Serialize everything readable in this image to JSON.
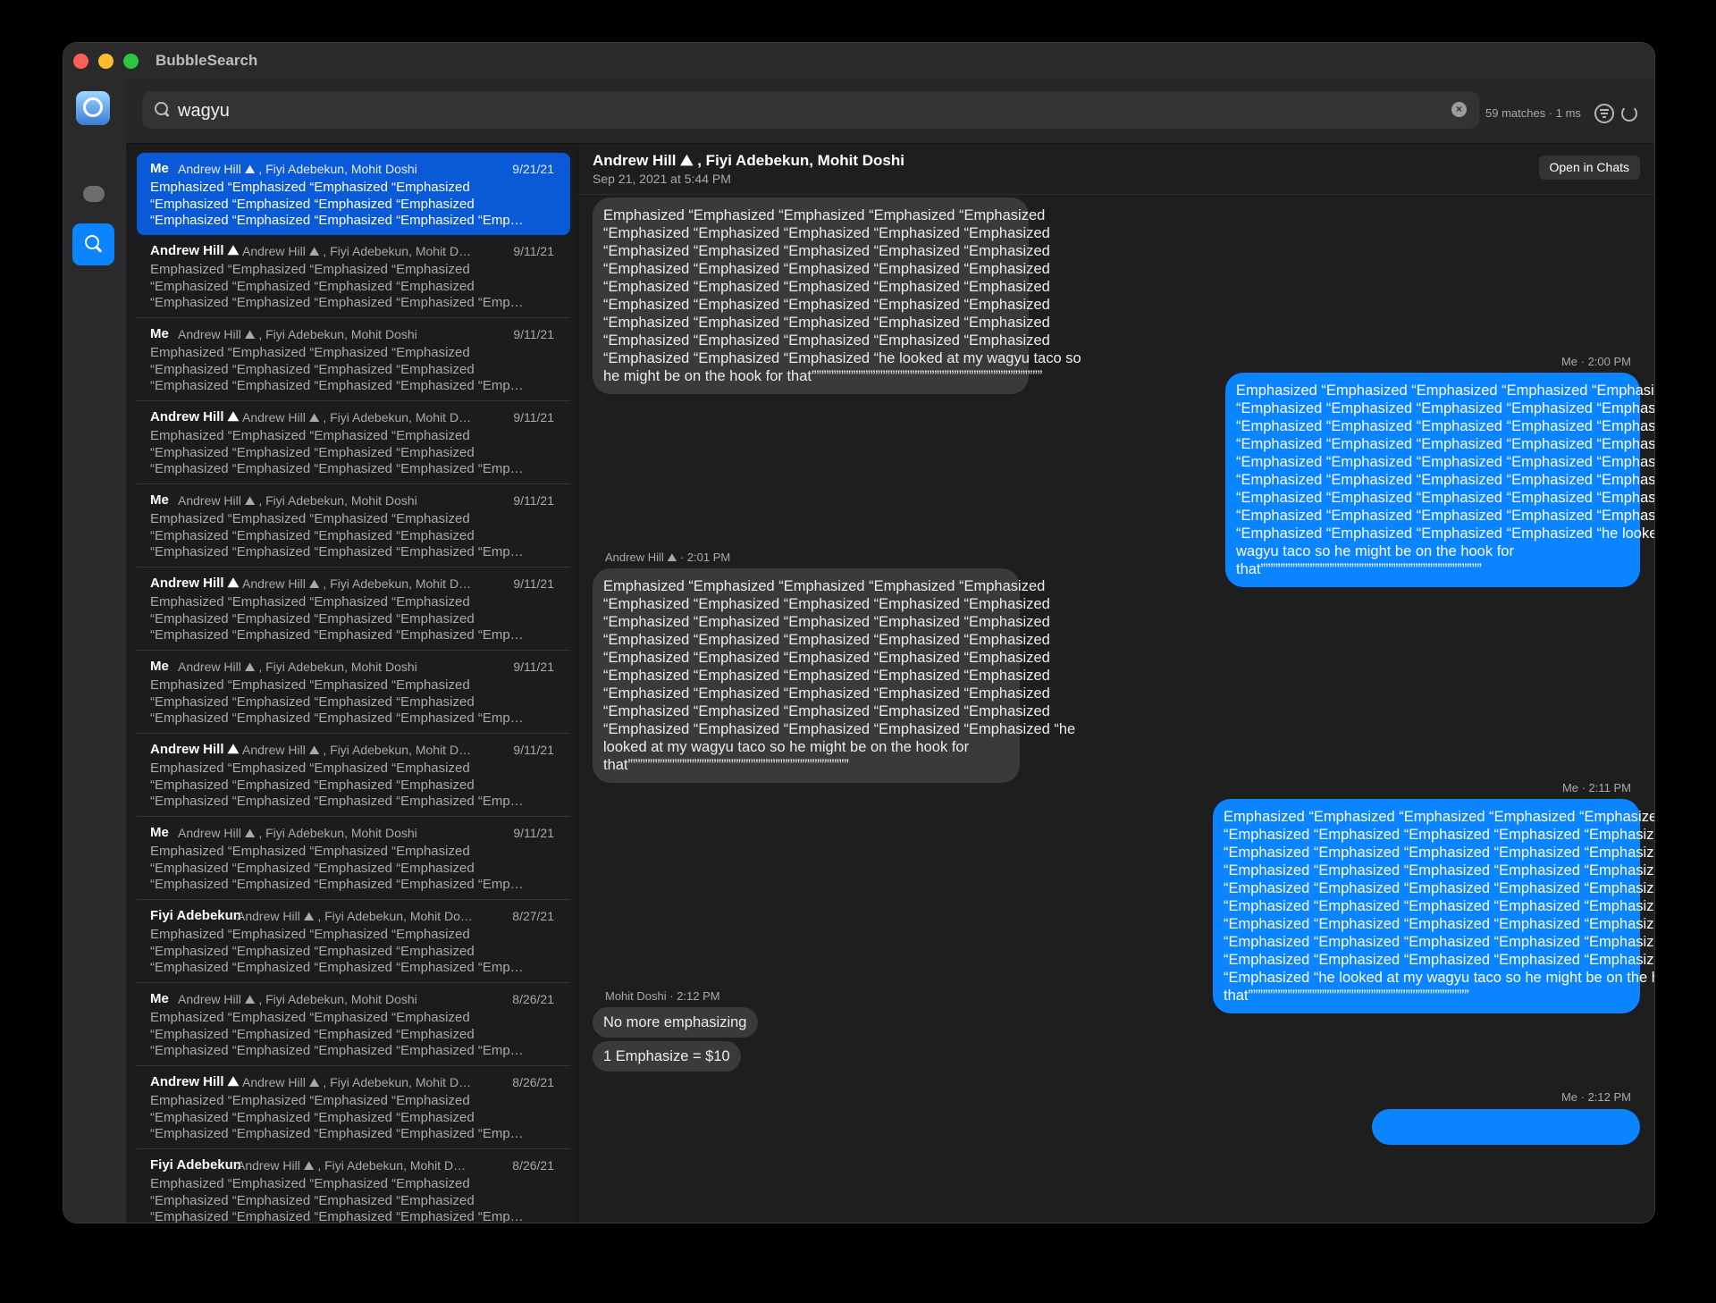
{
  "window": {
    "title": "BubbleSearch"
  },
  "search": {
    "query": "wagyu",
    "match_count": "59 matches · 1 ms"
  },
  "results": [
    {
      "sender": "Me",
      "group": "Andrew Hill ⛰ , Fiyi Adebekun, Mohit Doshi",
      "date": "9/21/21",
      "lines": [
        "Emphasized “Emphasized “Emphasized “Emphasized",
        "“Emphasized “Emphasized “Emphasized “Emphasized",
        "“Emphasized “Emphasized “Emphasized “Emphasized “Emp…"
      ]
    },
    {
      "sender": "Andrew Hill ⛰",
      "group": "Andrew Hill ⛰ , Fiyi Adebekun, Mohit D…",
      "date": "9/11/21",
      "lines": [
        "Emphasized “Emphasized “Emphasized “Emphasized",
        "“Emphasized “Emphasized “Emphasized “Emphasized",
        "“Emphasized “Emphasized “Emphasized “Emphasized “Emp…"
      ]
    },
    {
      "sender": "Me",
      "group": "Andrew Hill ⛰ , Fiyi Adebekun, Mohit Doshi",
      "date": "9/11/21",
      "lines": [
        "Emphasized “Emphasized “Emphasized “Emphasized",
        "“Emphasized “Emphasized “Emphasized “Emphasized",
        "“Emphasized “Emphasized “Emphasized “Emphasized “Emp…"
      ]
    },
    {
      "sender": "Andrew Hill ⛰",
      "group": "Andrew Hill ⛰ , Fiyi Adebekun, Mohit D…",
      "date": "9/11/21",
      "lines": [
        "Emphasized “Emphasized “Emphasized “Emphasized",
        "“Emphasized “Emphasized “Emphasized “Emphasized",
        "“Emphasized “Emphasized “Emphasized “Emphasized “Emp…"
      ]
    },
    {
      "sender": "Me",
      "group": "Andrew Hill ⛰ , Fiyi Adebekun, Mohit Doshi",
      "date": "9/11/21",
      "lines": [
        "Emphasized “Emphasized “Emphasized “Emphasized",
        "“Emphasized “Emphasized “Emphasized “Emphasized",
        "“Emphasized “Emphasized “Emphasized “Emphasized “Emp…"
      ]
    },
    {
      "sender": "Andrew Hill ⛰",
      "group": "Andrew Hill ⛰ , Fiyi Adebekun, Mohit D…",
      "date": "9/11/21",
      "lines": [
        "Emphasized “Emphasized “Emphasized “Emphasized",
        "“Emphasized “Emphasized “Emphasized “Emphasized",
        "“Emphasized “Emphasized “Emphasized “Emphasized “Emp…"
      ]
    },
    {
      "sender": "Me",
      "group": "Andrew Hill ⛰ , Fiyi Adebekun, Mohit Doshi",
      "date": "9/11/21",
      "lines": [
        "Emphasized “Emphasized “Emphasized “Emphasized",
        "“Emphasized “Emphasized “Emphasized “Emphasized",
        "“Emphasized “Emphasized “Emphasized “Emphasized “Emp…"
      ]
    },
    {
      "sender": "Andrew Hill ⛰",
      "group": "Andrew Hill ⛰ , Fiyi Adebekun, Mohit D…",
      "date": "9/11/21",
      "lines": [
        "Emphasized “Emphasized “Emphasized “Emphasized",
        "“Emphasized “Emphasized “Emphasized “Emphasized",
        "“Emphasized “Emphasized “Emphasized “Emphasized “Emp…"
      ]
    },
    {
      "sender": "Me",
      "group": "Andrew Hill ⛰ , Fiyi Adebekun, Mohit Doshi",
      "date": "9/11/21",
      "lines": [
        "Emphasized “Emphasized “Emphasized “Emphasized",
        "“Emphasized “Emphasized “Emphasized “Emphasized",
        "“Emphasized “Emphasized “Emphasized “Emphasized “Emp…"
      ]
    },
    {
      "sender": "Fiyi Adebekun",
      "group": "Andrew Hill ⛰ , Fiyi Adebekun, Mohit Do…",
      "date": "8/27/21",
      "lines": [
        "Emphasized “Emphasized “Emphasized “Emphasized",
        "“Emphasized “Emphasized “Emphasized “Emphasized",
        "“Emphasized “Emphasized “Emphasized “Emphasized “Emp…"
      ]
    },
    {
      "sender": "Me",
      "group": "Andrew Hill ⛰ , Fiyi Adebekun, Mohit Doshi",
      "date": "8/26/21",
      "lines": [
        "Emphasized “Emphasized “Emphasized “Emphasized",
        "“Emphasized “Emphasized “Emphasized “Emphasized",
        "“Emphasized “Emphasized “Emphasized “Emphasized “Emp…"
      ]
    },
    {
      "sender": "Andrew Hill ⛰",
      "group": "Andrew Hill ⛰ , Fiyi Adebekun, Mohit D…",
      "date": "8/26/21",
      "lines": [
        "Emphasized “Emphasized “Emphasized “Emphasized",
        "“Emphasized “Emphasized “Emphasized “Emphasized",
        "“Emphasized “Emphasized “Emphasized “Emphasized “Emp…"
      ]
    },
    {
      "sender": "Fiyi Adebekun",
      "group": "Andrew Hill ⛰ , Fiyi Adebekun, Mohit D…",
      "date": "8/26/21",
      "lines": [
        "Emphasized “Emphasized “Emphasized “Emphasized",
        "“Emphasized “Emphasized “Emphasized “Emphasized",
        "“Emphasized “Emphasized “Emphasized “Emphasized “Emp…"
      ]
    }
  ],
  "thread": {
    "title": "Andrew Hill ⛰ , Fiyi Adebekun, Mohit Doshi",
    "subtitle": "Sep 21, 2021 at 5:44 PM",
    "open_label": "Open in Chats",
    "messages": [
      {
        "id": "m1",
        "dir": "in",
        "meta": "",
        "lines": [
          "Emphasized “Emphasized “Emphasized “Emphasized “Emphasized",
          "“Emphasized “Emphasized “Emphasized “Emphasized “Emphasized",
          "“Emphasized “Emphasized “Emphasized “Emphasized “Emphasized",
          "“Emphasized “Emphasized “Emphasized “Emphasized “Emphasized",
          "“Emphasized “Emphasized “Emphasized “Emphasized “Emphasized",
          "“Emphasized “Emphasized “Emphasized “Emphasized “Emphasized",
          "“Emphasized “Emphasized “Emphasized “Emphasized “Emphasized",
          "“Emphasized “Emphasized “Emphasized “Emphasized “Emphasized",
          "“Emphasized “Emphasized “Emphasized “he looked at my wagyu taco so",
          "he might be on the hook for that”””””””””””””””””””””””””””””””””””””””””””””””"
        ]
      },
      {
        "id": "m2",
        "dir": "out",
        "meta": "Me · 2:00 PM",
        "lines": [
          "Emphasized “Emphasized “Emphasized “Emphasized “Emphasized",
          "“Emphasized “Emphasized “Emphasized “Emphasized “Emphasized",
          "“Emphasized “Emphasized “Emphasized “Emphasized “Emphasized",
          "“Emphasized “Emphasized “Emphasized “Emphasized “Emphasized",
          "“Emphasized “Emphasized “Emphasized “Emphasized “Emphasized",
          "“Emphasized “Emphasized “Emphasized “Emphasized “Emphasized",
          "“Emphasized “Emphasized “Emphasized “Emphasized “Emphasized",
          "“Emphasized “Emphasized “Emphasized “Emphasized “Emphasized",
          "“Emphasized “Emphasized “Emphasized “Emphasized “he looked at my",
          "wagyu taco so he might be on the hook for",
          "that”””””””””””””””””””””””””””””””””””””””””””””"
        ]
      },
      {
        "id": "m3",
        "dir": "in",
        "meta": "Andrew Hill ⛰ · 2:01 PM",
        "lines": [
          "Emphasized “Emphasized “Emphasized “Emphasized “Emphasized",
          "“Emphasized “Emphasized “Emphasized “Emphasized “Emphasized",
          "“Emphasized “Emphasized “Emphasized “Emphasized “Emphasized",
          "“Emphasized “Emphasized “Emphasized “Emphasized “Emphasized",
          "“Emphasized “Emphasized “Emphasized “Emphasized “Emphasized",
          "“Emphasized “Emphasized “Emphasized “Emphasized “Emphasized",
          "“Emphasized “Emphasized “Emphasized “Emphasized “Emphasized",
          "“Emphasized “Emphasized “Emphasized “Emphasized “Emphasized",
          "“Emphasized “Emphasized “Emphasized “Emphasized “Emphasized “he",
          "looked at my wagyu taco so he might be on the hook for",
          "that”””””””””””””””””””””””””””””””””””””””””””””"
        ]
      },
      {
        "id": "m4",
        "dir": "out",
        "meta": "Me · 2:11 PM",
        "lines": [
          "Emphasized “Emphasized “Emphasized “Emphasized “Emphasized",
          "“Emphasized “Emphasized “Emphasized “Emphasized “Emphasized",
          "“Emphasized “Emphasized “Emphasized “Emphasized “Emphasized",
          "“Emphasized “Emphasized “Emphasized “Emphasized “Emphasized",
          "“Emphasized “Emphasized “Emphasized “Emphasized “Emphasized",
          "“Emphasized “Emphasized “Emphasized “Emphasized “Emphasized",
          "“Emphasized “Emphasized “Emphasized “Emphasized “Emphasized",
          "“Emphasized “Emphasized “Emphasized “Emphasized “Emphasized",
          "“Emphasized “Emphasized “Emphasized “Emphasized “Emphasized",
          "“Emphasized “he looked at my wagyu taco so he might be on the hook for",
          "that”””””””””””””””””””””””””””””””””””””””””””””"
        ]
      },
      {
        "id": "m5",
        "dir": "in",
        "meta": "Mohit Doshi · 2:12 PM",
        "lines": [
          "No more emphasizing"
        ]
      },
      {
        "id": "m6",
        "dir": "in",
        "meta": "",
        "lines": [
          "1 Emphasize = $10"
        ]
      },
      {
        "id": "m7",
        "dir": "out",
        "meta": "Me · 2:12 PM",
        "lines": []
      }
    ]
  }
}
